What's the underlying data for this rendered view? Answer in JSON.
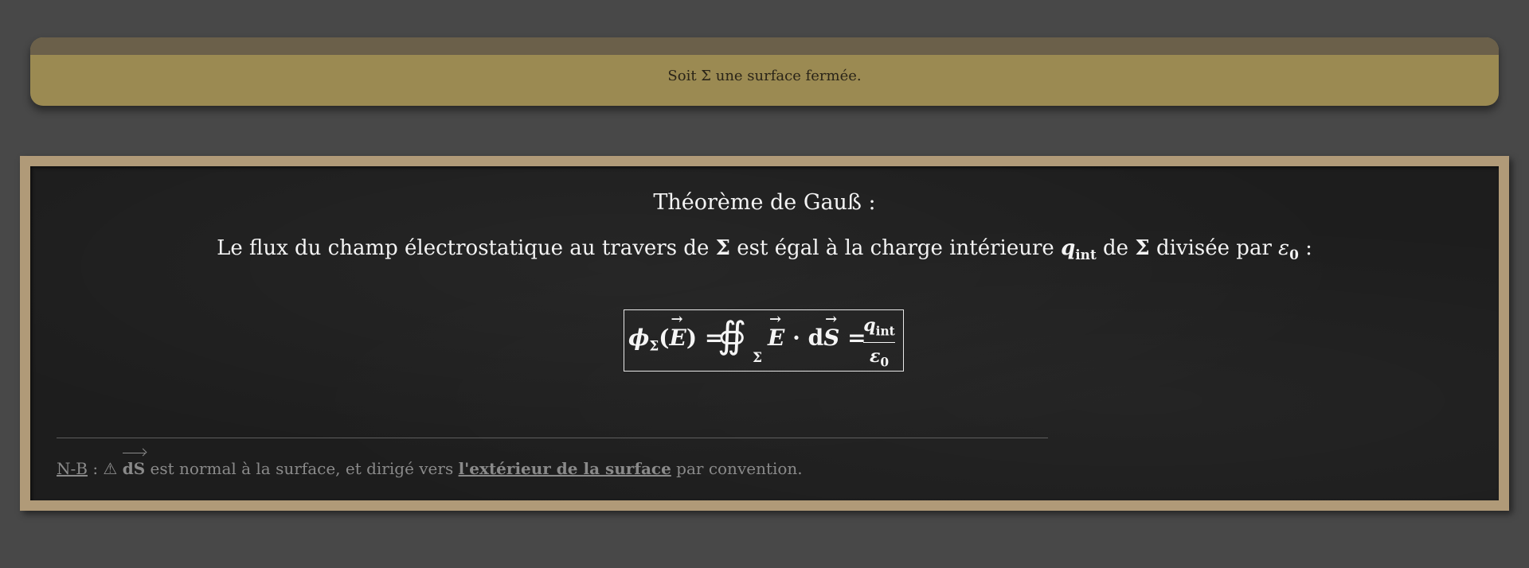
{
  "note": {
    "text": "Soit Σ une surface fermée."
  },
  "board": {
    "title": "Théorème de Gauß :",
    "statement": {
      "part1": "Le flux du champ électrostatique au travers de ",
      "sigma1": "Σ",
      "part2": " est égal à la charge intérieure ",
      "q": "q",
      "q_sub": "int",
      "part3": " de ",
      "sigma2": "Σ",
      "part4": " divisée par ",
      "eps": "ε",
      "eps_sub": "0",
      "part5": " :"
    },
    "formula": {
      "lhs_phi": "ϕ",
      "lhs_sub": "Σ",
      "lhs_paren_open": "(",
      "lhs_E": "E",
      "lhs_paren_close_eq": ") =",
      "integral": "∯",
      "integral_sub": "Σ",
      "E": "E",
      "dot_d": " · d",
      "S": "S",
      "eq": " =",
      "num_q": "q",
      "num_sub": "int",
      "den_eps": "ε",
      "den_sub": "0"
    },
    "nb": {
      "label": "N-B",
      "sep": " : ⚠ ",
      "ds": "dS",
      "text1": " est normal à la surface, et dirigé vers ",
      "emphasis": "l'extérieur de la surface",
      "text2": " par convention."
    }
  }
}
